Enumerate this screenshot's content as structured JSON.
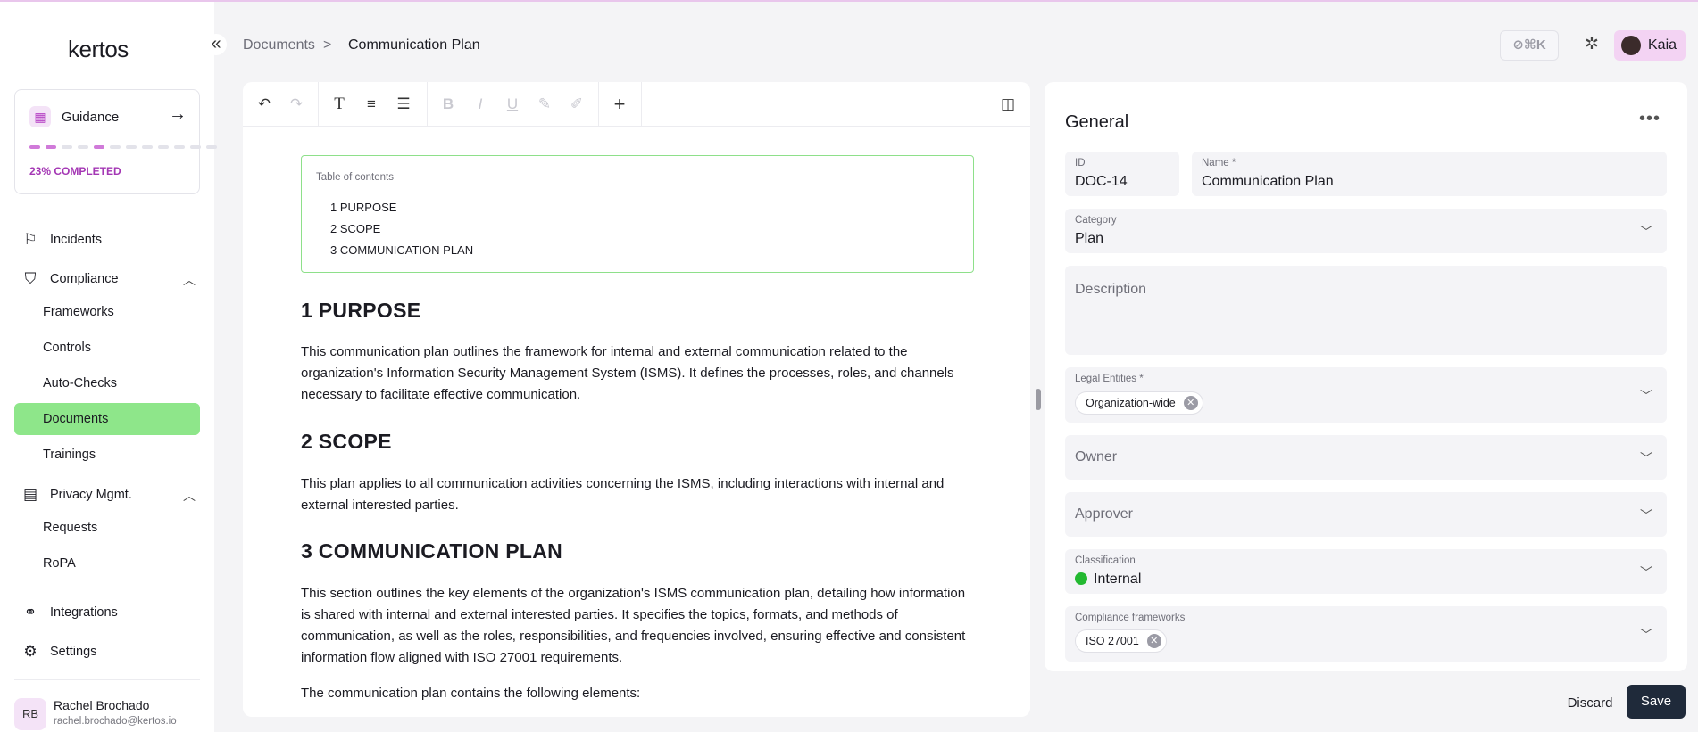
{
  "app": {
    "logo": "kertos"
  },
  "breadcrumb": {
    "parent": "Documents",
    "separator": ">",
    "current": "Communication Plan"
  },
  "header": {
    "shortcut": "⊘⌘K",
    "user_name": "Kaia"
  },
  "guidance": {
    "label": "Guidance",
    "progress_text": "23% COMPLETED",
    "progress_fraction": 0.23
  },
  "sidebar": {
    "incidents": "Incidents",
    "compliance": "Compliance",
    "compliance_items": [
      "Frameworks",
      "Controls",
      "Auto-Checks",
      "Documents",
      "Trainings"
    ],
    "privacy": "Privacy Mgmt.",
    "privacy_items": [
      "Requests",
      "RoPA"
    ],
    "integrations": "Integrations",
    "settings": "Settings"
  },
  "user": {
    "initials": "RB",
    "name": "Rachel Brochado",
    "email": "rachel.brochado@kertos.io"
  },
  "editor": {
    "toc_title": "Table of contents",
    "toc": [
      "1 PURPOSE",
      "2 SCOPE",
      "3 COMMUNICATION PLAN"
    ],
    "h_purpose": "1 PURPOSE",
    "p_purpose": "This communication plan outlines the framework for internal and external communication related to the organization's Information Security Management System (ISMS). It defines the processes, roles, and channels necessary to facilitate effective communication.",
    "h_scope": "2 SCOPE",
    "p_scope": "This plan applies to all communication activities concerning the ISMS, including interactions with internal and external interested parties.",
    "h_plan": "3 COMMUNICATION PLAN",
    "p_plan": "This section outlines the key elements of the organization's ISMS communication plan, detailing how information is shared with internal and external interested parties. It specifies the topics, formats, and methods of communication, as well as the roles, responsibilities, and frequencies involved, ensuring effective and consistent information flow aligned with ISO 27001 requirements.",
    "p_elements": "The communication plan contains the following elements:"
  },
  "panel": {
    "title": "General",
    "id_label": "ID",
    "id_value": "DOC-14",
    "name_label": "Name *",
    "name_value": "Communication Plan",
    "category_label": "Category",
    "category_value": "Plan",
    "description_placeholder": "Description",
    "legal_label": "Legal Entities *",
    "legal_chip": "Organization-wide",
    "owner_placeholder": "Owner",
    "approver_placeholder": "Approver",
    "classification_label": "Classification",
    "classification_value": "Internal",
    "frameworks_label": "Compliance frameworks",
    "frameworks_chip": "ISO 27001"
  },
  "actions": {
    "discard": "Discard",
    "save": "Save"
  },
  "colors": {
    "accent_green": "#8ee68a",
    "accent_purple": "#a437b4",
    "save_bg": "#1f2a3a",
    "status_internal": "#23b931"
  }
}
